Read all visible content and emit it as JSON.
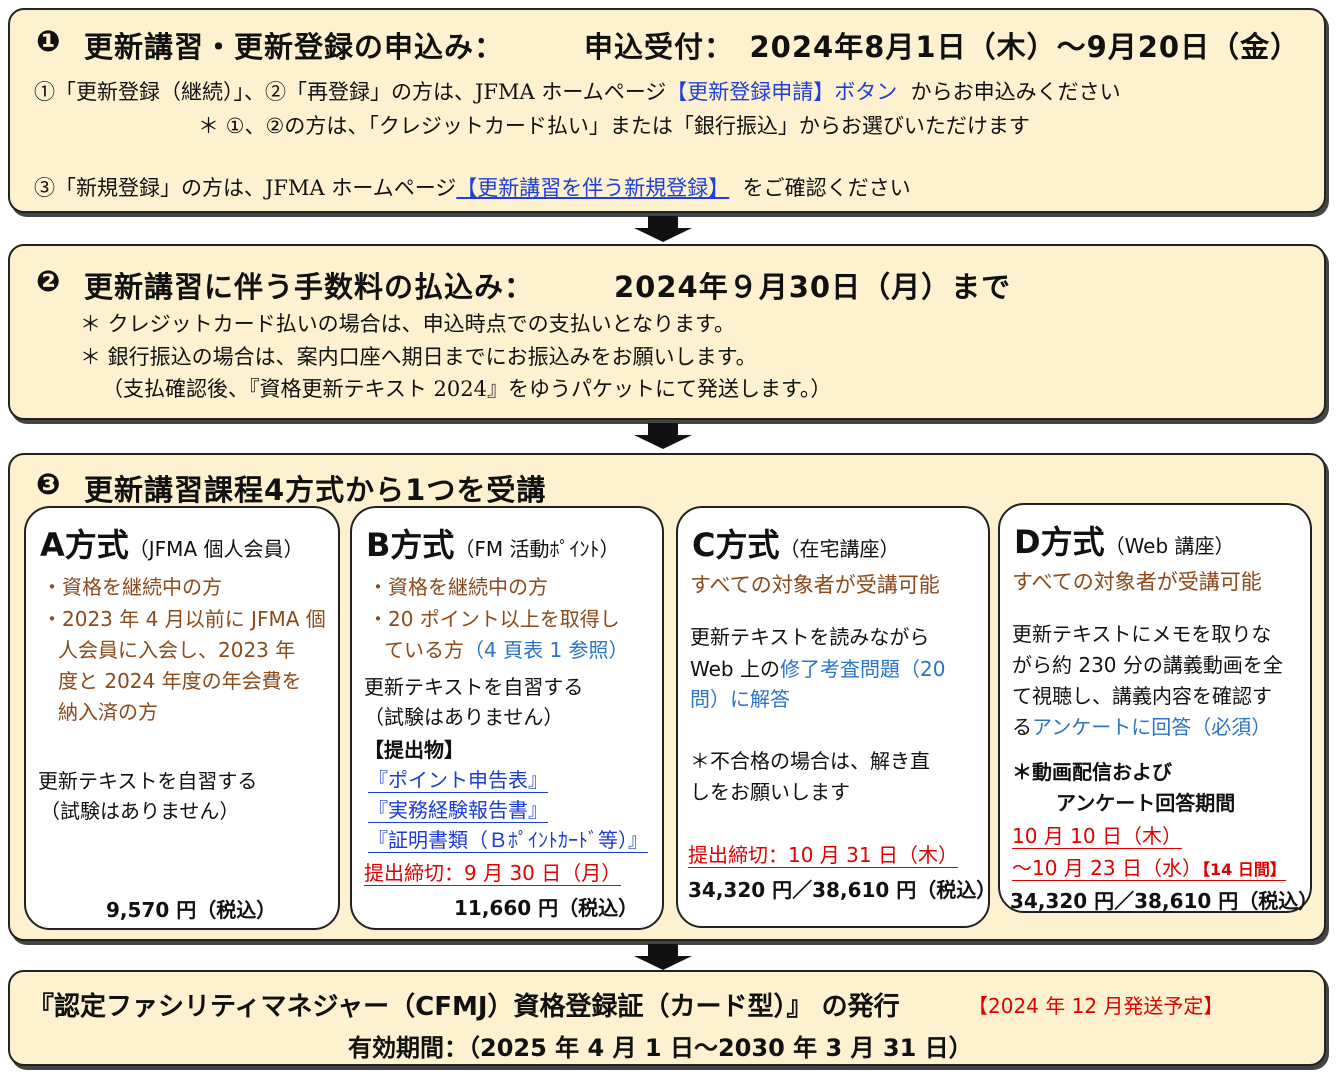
{
  "step1": {
    "num": "❶",
    "title": "更新講習・更新登録の申込み：",
    "period": "申込受付：　2024年8月1日（木）～9月20日（金）",
    "line1_pre": "①「更新登録（継続）」、②「再登録」の方は、JFMA ホームページ",
    "line1_link": "【更新登録申請】ボタン",
    "line1_post": "からお申込みください",
    "line2": "＊ ①、②の方は、「クレジットカード払い」または「銀行振込」からお選びいただけます",
    "line3_pre": "③「新規登録」の方は、JFMA ホームページ",
    "line3_link": "【更新講習を伴う新規登録】",
    "line3_post": "をご確認ください"
  },
  "step2": {
    "num": "❷",
    "title": "更新講習に伴う手数料の払込み：",
    "period": "2024年９月30日（月）まで",
    "line1": "＊ クレジットカード払いの場合は、申込時点での支払いとなります。",
    "line2": "＊ 銀行振込の場合は、案内口座へ期日までにお振込みをお願いします。",
    "line3": "（支払確認後、『資格更新テキスト 2024』をゆうパケットにて発送します。）"
  },
  "step3": {
    "num": "❸",
    "title": "更新講習課程4方式から1つを受講"
  },
  "cards": {
    "a": {
      "title": "A方式",
      "sub": "（JFMA 個人会員）",
      "b1": "・資格を継続中の方",
      "b2a": "・2023 年 4 月以前に JFMA 個",
      "b2b": "人会員に入会し、2023 年",
      "b2c": "度と 2024 年度の年会費を",
      "b2d": "納入済の方",
      "d1": "更新テキストを自習する",
      "d2": "（試験はありません）",
      "price": "9,570 円（税込）"
    },
    "b": {
      "title": "B方式",
      "sub": "（FM 活動ﾎﾟｲﾝﾄ）",
      "b1": "・資格を継続中の方",
      "b2a": "・20 ポイント以上を取得し",
      "b2b": "ている方",
      "b2ref": "（4 頁表 1 参照）",
      "d1": "更新テキストを自習する",
      "d2": "（試験はありません）",
      "sub_head": "【提出物】",
      "s1": "『ポイント申告表』",
      "s2": "『実務経験報告書』",
      "s3": "『証明書類（Ｂﾎﾟｲﾝﾄｶｰﾄﾞ等）』",
      "deadline": "提出締切：9 月 30 日（月）",
      "price": "11,660 円（税込）"
    },
    "c": {
      "title": "C方式",
      "sub": "（在宅講座）",
      "target": "すべての対象者が受講可能",
      "d1": "更新テキストを読みながら",
      "d2a": "Web 上の",
      "d2b": "修了考査問題（20",
      "d3": "問）に解答",
      "n1": "＊不合格の場合は、解き直",
      "n2": "しをお願いします",
      "deadline": "提出締切：10 月 31 日（木）",
      "price": "34,320 円／38,610 円（税込）"
    },
    "d": {
      "title": "D方式",
      "sub": "（Web 講座）",
      "target": "すべての対象者が受講可能",
      "d1": "更新テキストにメモを取りな",
      "d2": "がら約 230 分の講義動画を全",
      "d3": "て視聴し、講義内容を確認す",
      "d4a": "る",
      "d4b": "アンケートに回答（必須）",
      "n1": "＊動画配信および",
      "n2": "アンケート回答期間",
      "p1": "10 月 10 日（木）",
      "p2": "～10 月 23 日（水）",
      "p2b": "【14 日間】",
      "price": "34,320 円／38,610 円（税込）"
    }
  },
  "step4": {
    "title": "『認定ファシリティマネジャー（CFMJ）資格登録証（カード型）』 の発行",
    "note": "【2024 年 12 月発送予定】",
    "validity": "有効期間：（2025 年 4 月 1 日～2030 年 3 月 31 日）"
  }
}
